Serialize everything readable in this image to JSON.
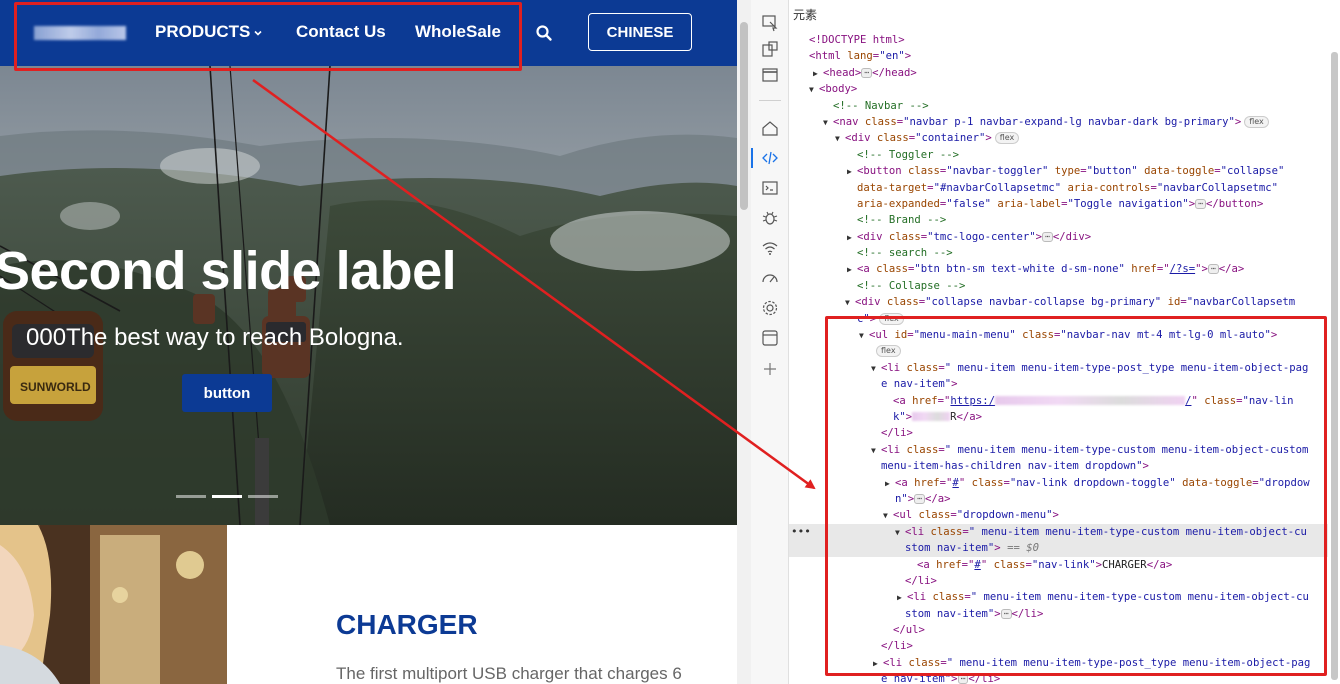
{
  "site": {
    "navbar": {
      "products_label": "PRODUCTS",
      "contact_label": "Contact Us",
      "wholesale_label": "WholeSale",
      "language_button": "CHINESE",
      "brand_color": "#0c3a94"
    },
    "hero": {
      "title": "Second slide label",
      "subtitle": "000The best way to reach Bologna.",
      "button_label": "button",
      "indicators": [
        "inactive",
        "active",
        "inactive"
      ]
    },
    "product": {
      "title": "CHARGER",
      "description": "The first multiport USB charger that charges 6"
    }
  },
  "devtools": {
    "panel_title": "元素",
    "icons": [
      "inspect-icon",
      "device-toolbar-icon",
      "window-icon",
      "home-icon",
      "elements-icon",
      "console-icon",
      "debugger-icon",
      "network-icon",
      "performance-icon",
      "settings-icon",
      "application-icon",
      "add-icon"
    ],
    "lines": {
      "l1": "<!DOCTYPE html>",
      "l2_tag": "<html ",
      "l2_attr": "lang",
      "l2_val": "\"en\"",
      "l3_open": "<head>",
      "l3_close": "</head>",
      "l4": "<body>",
      "l5": "<!-- Navbar -->",
      "l6_tag": "<nav ",
      "l6_attr": "class",
      "l6_val": "\"navbar p-1 navbar-expand-lg navbar-dark bg-primary\"",
      "l7_tag": "<div ",
      "l7_attr": "class",
      "l7_val": "\"container\"",
      "l8": "<!-- Toggler -->",
      "l9_tag": "<button ",
      "l9_a1": "class",
      "l9_v1": "\"navbar-toggler\"",
      "l9_a2": "type",
      "l9_v2": "\"button\"",
      "l9_a3": "data-toggle",
      "l9_v3": "\"collapse\"",
      "l10_a1": "data-target",
      "l10_v1": "\"#navbarCollapsetmc\"",
      "l10_a2": "aria-controls",
      "l10_v2": "\"navbarCollapsetmc\"",
      "l11_a1": "aria-expanded",
      "l11_v1": "\"false\"",
      "l11_a2": "aria-label",
      "l11_v2": "\"Toggle navigation\"",
      "l11_close": "</button>",
      "l12": "<!-- Brand -->",
      "l13_tag": "<div ",
      "l13_attr": "class",
      "l13_val": "\"tmc-logo-center\"",
      "l13_close": "</div>",
      "l14": "<!-- search -->",
      "l15_tag": "<a ",
      "l15_a1": "class",
      "l15_v1": "\"btn btn-sm text-white d-sm-none\"",
      "l15_a2": "href",
      "l15_v2": "/?s=",
      "l15_close": "</a>",
      "l16": "<!-- Collapse -->",
      "l17_tag": "<div ",
      "l17_a1": "class",
      "l17_v1": "\"collapse navbar-collapse bg-primary\"",
      "l17_a2": "id",
      "l17_v2a": "\"navbarCollapsetm",
      "l18_v2b": "c\"",
      "l19_tag": "<ul ",
      "l19_a1": "id",
      "l19_v1": "\"menu-main-menu\"",
      "l19_a2": "class",
      "l19_v2": "\"navbar-nav mt-4 mt-lg-0 ml-auto\"",
      "l21_tag": "<li ",
      "l21_a1": "class",
      "l21_v1": "\" menu-item menu-item-type-post_type menu-item-object-pag",
      "l22_v1": "e nav-item\"",
      "l23_tag": "<a ",
      "l23_a1": "href",
      "l23_v1a": "https:/",
      "l23_v1b": "/",
      "l23_a2": "class",
      "l23_v2": "\"nav-lin",
      "l24_v2": "k\"",
      "l24_tx": "R",
      "l24_close": "</a>",
      "l25": "</li>",
      "l26_tag": "<li ",
      "l26_a1": "class",
      "l26_v1": "\" menu-item menu-item-type-custom menu-item-object-custom",
      "l27_v1": "menu-item-has-children nav-item dropdown\"",
      "l28_tag": "<a ",
      "l28_a1": "href",
      "l28_v1": "#",
      "l28_a2": "class",
      "l28_v2": "\"nav-link dropdown-toggle\"",
      "l28_a3": "data-toggle",
      "l28_v3": "\"dropdow",
      "l29_v3": "n\"",
      "l29_close": "</a>",
      "l30_tag": "<ul ",
      "l30_a1": "class",
      "l30_v1": "\"dropdown-menu\"",
      "l31_tag": "<li ",
      "l31_a1": "class",
      "l31_v1": "\" menu-item menu-item-type-custom menu-item-object-cu",
      "l32_v1": "stom nav-item\"",
      "l32_eq": "== $0",
      "l33_tag": "<a ",
      "l33_a1": "href",
      "l33_v1": "#",
      "l33_a2": "class",
      "l33_v2": "\"nav-link\"",
      "l33_tx": "CHARGER",
      "l33_close": "</a>",
      "l34": "</li>",
      "l35_tag": "<li ",
      "l35_a1": "class",
      "l35_v1": "\" menu-item menu-item-type-custom menu-item-object-cu",
      "l36_v1": "stom nav-item\"",
      "l36_close": "</li>",
      "l37": "</ul>",
      "l38": "</li>",
      "l39_tag": "<li ",
      "l39_a1": "class",
      "l39_v1": "\" menu-item menu-item-type-post_type menu-item-object-pag",
      "l40_v1": "e nav-item\"",
      "l40_close": "</li>",
      "badge_flex": "flex",
      "ellipsis": "⋯"
    }
  },
  "annotation_color": "#e02020"
}
